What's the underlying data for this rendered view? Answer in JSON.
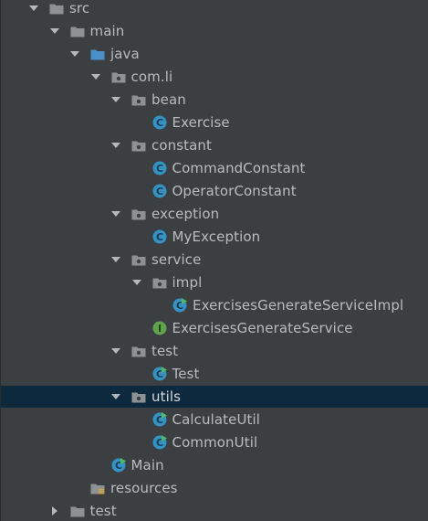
{
  "colors": {
    "background": "#3c3f41",
    "selection": "#0d293e",
    "text": "#bbbbbb",
    "folder": "#8d9194",
    "class_icon": "#3592c4",
    "interface_icon": "#5fa34c",
    "run_badge": "#4dbb5f"
  },
  "tree": {
    "nodes": [
      {
        "label": "src",
        "icon": "folder-icon",
        "arrow": "down"
      },
      {
        "label": "main",
        "icon": "folder-icon",
        "arrow": "down"
      },
      {
        "label": "java",
        "icon": "source-folder-icon",
        "arrow": "down"
      },
      {
        "label": "com.li",
        "icon": "package-icon",
        "arrow": "down"
      },
      {
        "label": "bean",
        "icon": "package-icon",
        "arrow": "down"
      },
      {
        "label": "Exercise",
        "icon": "class-icon",
        "arrow": "none"
      },
      {
        "label": "constant",
        "icon": "package-icon",
        "arrow": "down"
      },
      {
        "label": "CommandConstant",
        "icon": "class-icon",
        "arrow": "none"
      },
      {
        "label": "OperatorConstant",
        "icon": "class-icon",
        "arrow": "none"
      },
      {
        "label": "exception",
        "icon": "package-icon",
        "arrow": "down"
      },
      {
        "label": "MyException",
        "icon": "class-icon",
        "arrow": "none"
      },
      {
        "label": "service",
        "icon": "package-icon",
        "arrow": "down"
      },
      {
        "label": "impl",
        "icon": "package-icon",
        "arrow": "down"
      },
      {
        "label": "ExercisesGenerateServiceImpl",
        "icon": "runnable-class-icon",
        "arrow": "none"
      },
      {
        "label": "ExercisesGenerateService",
        "icon": "interface-icon",
        "arrow": "none"
      },
      {
        "label": "test",
        "icon": "package-icon",
        "arrow": "down"
      },
      {
        "label": "Test",
        "icon": "runnable-class-icon",
        "arrow": "none"
      },
      {
        "label": "utils",
        "icon": "package-icon",
        "arrow": "down",
        "selected": true
      },
      {
        "label": "CalculateUtil",
        "icon": "runnable-class-icon",
        "arrow": "none"
      },
      {
        "label": "CommonUtil",
        "icon": "runnable-class-icon",
        "arrow": "none"
      },
      {
        "label": "Main",
        "icon": "runnable-class-icon",
        "arrow": "none"
      },
      {
        "label": "resources",
        "icon": "resources-folder-icon",
        "arrow": "none"
      },
      {
        "label": "test",
        "icon": "folder-icon",
        "arrow": "right"
      }
    ]
  }
}
